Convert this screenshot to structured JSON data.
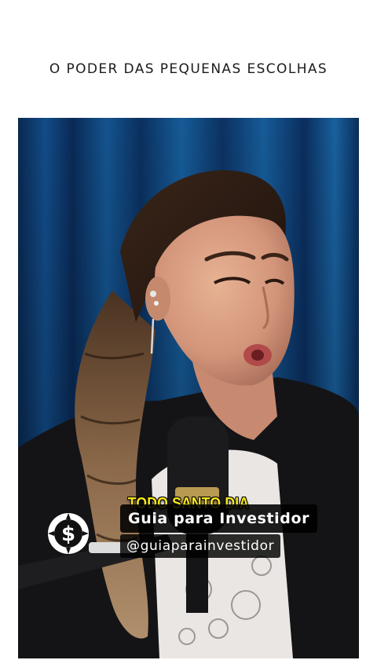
{
  "headline": "O PODER DAS PEQUENAS ESCOLHAS",
  "video": {
    "caption": "TODO SANTO DIA",
    "caption_color": "#f6e71c",
    "channel": {
      "icon": "dollar-coin-icon",
      "name": "Guia para Investidor",
      "handle": "@guiaparainvestidor"
    }
  },
  "colors": {
    "background": "#ffffff",
    "headline_text": "#1b1b1b",
    "curtain_blue": "#0d3a6e"
  }
}
